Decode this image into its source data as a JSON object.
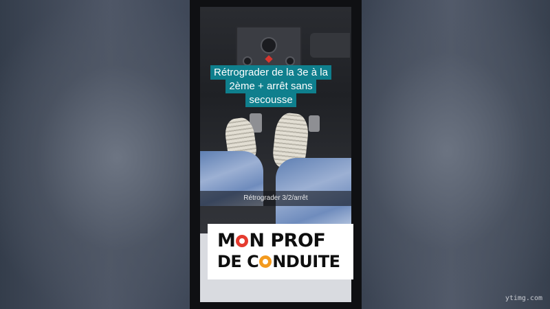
{
  "video": {
    "caption": "Rétrograder de la 3e à la 2ème + arrêt sans secousse",
    "bottom_label": "Rétrograder 3/2/arrêt"
  },
  "logo": {
    "line1": "MON PROF",
    "line2": "DE CONDUITE",
    "colors": [
      "#e53b2f",
      "#f39a1e",
      "#49b84a"
    ]
  },
  "watermark": "ytimg.com"
}
